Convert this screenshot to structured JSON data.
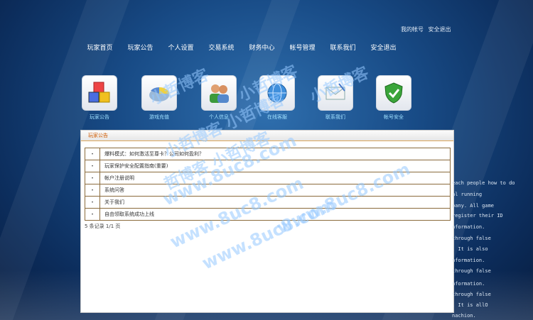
{
  "top_links": {
    "items": [
      "我的帐号",
      "安全退出"
    ]
  },
  "nav": {
    "items": [
      "玩家首页",
      "玩家公告",
      "个人设置",
      "交易系统",
      "财务中心",
      "帐号管理",
      "联系我们",
      "安全退出"
    ]
  },
  "icons": [
    {
      "label": "玩家公告",
      "icon": "cubes-icon"
    },
    {
      "label": "游戏充值",
      "icon": "pie-chart-icon"
    },
    {
      "label": "个人信息",
      "icon": "users-icon"
    },
    {
      "label": "在线客服",
      "icon": "globe-icon"
    },
    {
      "label": "联系我们",
      "icon": "mail-icon"
    },
    {
      "label": "帐号安全",
      "icon": "shield-icon"
    }
  ],
  "panel": {
    "title": "玩家公告",
    "rows": [
      "爆料模式：如何激活至尊卡？公司如何盈利？",
      "玩家保护安全配置指南(重要)",
      "帐户注册说明",
      "系统问答",
      "关于我们",
      "自由领取系统成功上线"
    ],
    "pager": "5 条记录 1/1 页"
  },
  "side_text": [
    "each people how to do",
    "al running",
    "pany. All game",
    "register their ID",
    "nformation.",
    "through false",
    ". It is also",
    "nformation.",
    "through false",
    "nformation.",
    "through false",
    ". It is allO",
    "nachion."
  ],
  "watermarks": [
    "小哲博客",
    "小哲博客",
    "小哲博客",
    "小哲博客 小哲博客",
    "哲博客 小哲博客",
    "www.8uc8.com",
    "www.8uc8.com",
    "www.8uc8.com",
    "www.8uc8.com"
  ]
}
